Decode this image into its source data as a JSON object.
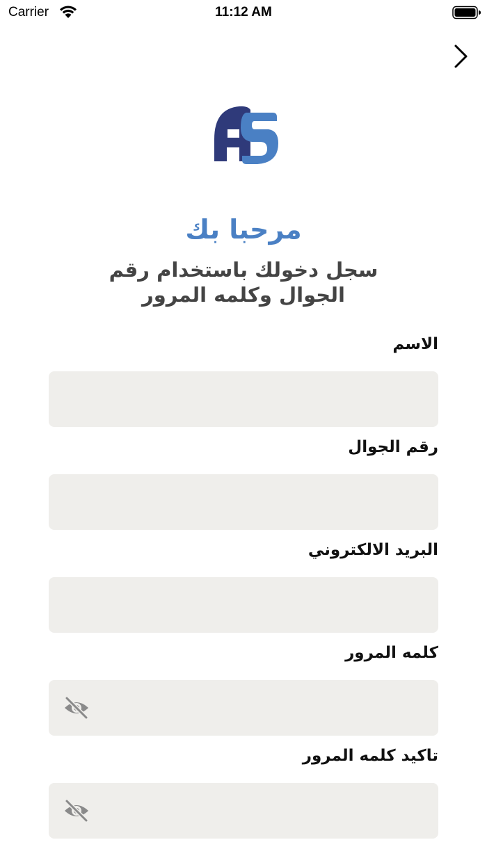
{
  "status_bar": {
    "carrier": "Carrier",
    "time": "11:12 AM"
  },
  "header": {
    "title": "مرحبا بك",
    "subtitle_line1": "سجل دخولك باستخدام رقم",
    "subtitle_line2": "الجوال وكلمه المرور"
  },
  "form": {
    "name_label": "الاسم",
    "phone_label": "رقم الجوال",
    "email_label": "البريد الالكتروني",
    "password_label": "كلمه المرور",
    "confirm_password_label": "تاكيد كلمه المرور"
  },
  "colors": {
    "accent": "#4a80c4",
    "logo_dark": "#2f3a7a",
    "field_bg": "#efeeeb"
  }
}
